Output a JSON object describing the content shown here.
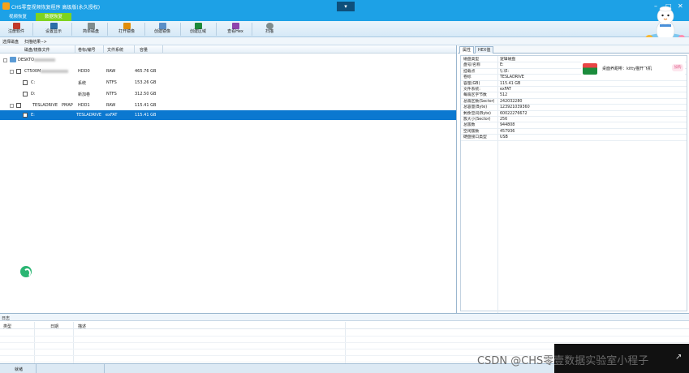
{
  "window": {
    "title": "CHS零壹视频恢复程序 高级版(永久授权)",
    "collapse_glyph": "▾",
    "controls": [
      "–",
      "□",
      "✕"
    ]
  },
  "tabs": [
    {
      "label": "视频恢复",
      "active": false
    },
    {
      "label": "数据恢复",
      "active": true
    }
  ],
  "toolbar": [
    {
      "label": "注册软件",
      "icon": "register-icon",
      "color": "#c0392b"
    },
    {
      "label": "设置显示",
      "icon": "display-icon",
      "color": "#2c6ea8"
    },
    {
      "label": "简单磁盘",
      "icon": "disk-icon",
      "color": "#7f8c8d"
    },
    {
      "label": "打开镜像",
      "icon": "open-image-icon",
      "color": "#e08e0b"
    },
    {
      "label": "创建镜像",
      "icon": "create-image-icon",
      "color": "#5b8fc7"
    },
    {
      "label": "创建区域",
      "icon": "create-region-icon",
      "color": "#1e8a3a"
    },
    {
      "label": "查看Hex",
      "icon": "hex-icon",
      "color": "#8e44ad"
    },
    {
      "label": "扫描",
      "icon": "scan-icon",
      "color": "#7f8c8d"
    }
  ],
  "breadcrumb": {
    "first": "选择磁盘",
    "second": "扫描结果-->"
  },
  "disk_table": {
    "headers": [
      "磁盘/镜像文件",
      "卷标/编号",
      "文件系统",
      "容量"
    ],
    "rows": [
      {
        "name": "DESKTO",
        "label": "",
        "fs": "",
        "size": "",
        "level": 0,
        "selected": false
      },
      {
        "name": "CT500M",
        "label": "HDD0",
        "fs": "RAW",
        "size": "465.76 GB",
        "level": 1,
        "selected": false
      },
      {
        "name": "C:",
        "label": "系统",
        "fs": "NTFS",
        "size": "153.26 GB",
        "level": 2,
        "selected": false
      },
      {
        "name": "D:",
        "label": "新加卷",
        "fs": "NTFS",
        "size": "312.50 GB",
        "level": 2,
        "selected": false
      },
      {
        "name": "TESLADRIVE",
        "suffix": "PMAP",
        "label": "HDD1",
        "fs": "RAW",
        "size": "115.41 GB",
        "level": 1,
        "selected": false
      },
      {
        "name": "E:",
        "label": "TESLADRIVE",
        "fs": "exFAT",
        "size": "115.41 GB",
        "level": 2,
        "selected": true
      }
    ]
  },
  "properties": {
    "tabs": [
      {
        "label": "属性",
        "active": true
      },
      {
        "label": "HEX值",
        "active": false
      }
    ],
    "rows": [
      {
        "k": "磁盘类型",
        "v": "逻辑磁盘"
      },
      {
        "k": "盘号/名称",
        "v": "E:"
      },
      {
        "k": "挂载点",
        "v": "\\\\.\\E:"
      },
      {
        "k": "卷标",
        "v": "TESLADRIVE"
      },
      {
        "k": "容量(GB)",
        "v": "115.41 GB"
      },
      {
        "k": "文件系统:",
        "v": "exFAT"
      },
      {
        "k": "每扇区字节数",
        "v": "512"
      },
      {
        "k": "总扇区数(Sector)",
        "v": "242032280"
      },
      {
        "k": "总容量(Byte)",
        "v": "123921039360"
      },
      {
        "k": "剩余空间(Byte)",
        "v": "60022276672"
      },
      {
        "k": "簇大小(Sector)",
        "v": "256"
      },
      {
        "k": "总簇数",
        "v": "944808"
      },
      {
        "k": "空闲簇数",
        "v": "457936"
      },
      {
        "k": "硬盘接口类型",
        "v": "USB"
      }
    ]
  },
  "notification": {
    "text": "桌面养甜啡：kitty猫开飞机",
    "button": "加购"
  },
  "log": {
    "title": "日志",
    "headers": [
      "类型",
      "日期",
      "描述"
    ]
  },
  "status": {
    "text": "就绪"
  },
  "watermark": "CSDN @CHS零壹数据实验室小程子"
}
